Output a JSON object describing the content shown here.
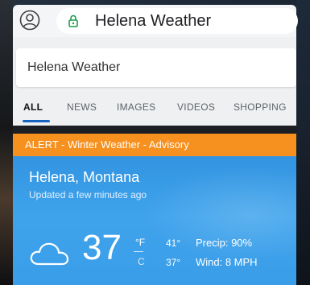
{
  "browser": {
    "address_text": "Helena Weather",
    "profile_icon": "profile-icon",
    "lock_icon": "lock-icon"
  },
  "search": {
    "query": "Helena Weather",
    "tabs": [
      {
        "label": "ALL",
        "active": true
      },
      {
        "label": "NEWS",
        "active": false
      },
      {
        "label": "IMAGES",
        "active": false
      },
      {
        "label": "VIDEOS",
        "active": false
      },
      {
        "label": "SHOPPING",
        "active": false
      }
    ]
  },
  "weather": {
    "alert": "ALERT - Winter Weather - Advisory",
    "location": "Helena, Montana",
    "updated": "Updated a few minutes ago",
    "condition_icon": "cloud-icon",
    "temperature": "37",
    "unit_f": "°F",
    "unit_c": "C",
    "high": "41°",
    "low": "37°",
    "precip": "Precip: 90%",
    "wind": "Wind: 8 MPH"
  },
  "colors": {
    "alert_orange": "#f6901e",
    "card_blue": "#3fa3ec",
    "active_tab_underline": "#1565c0"
  }
}
